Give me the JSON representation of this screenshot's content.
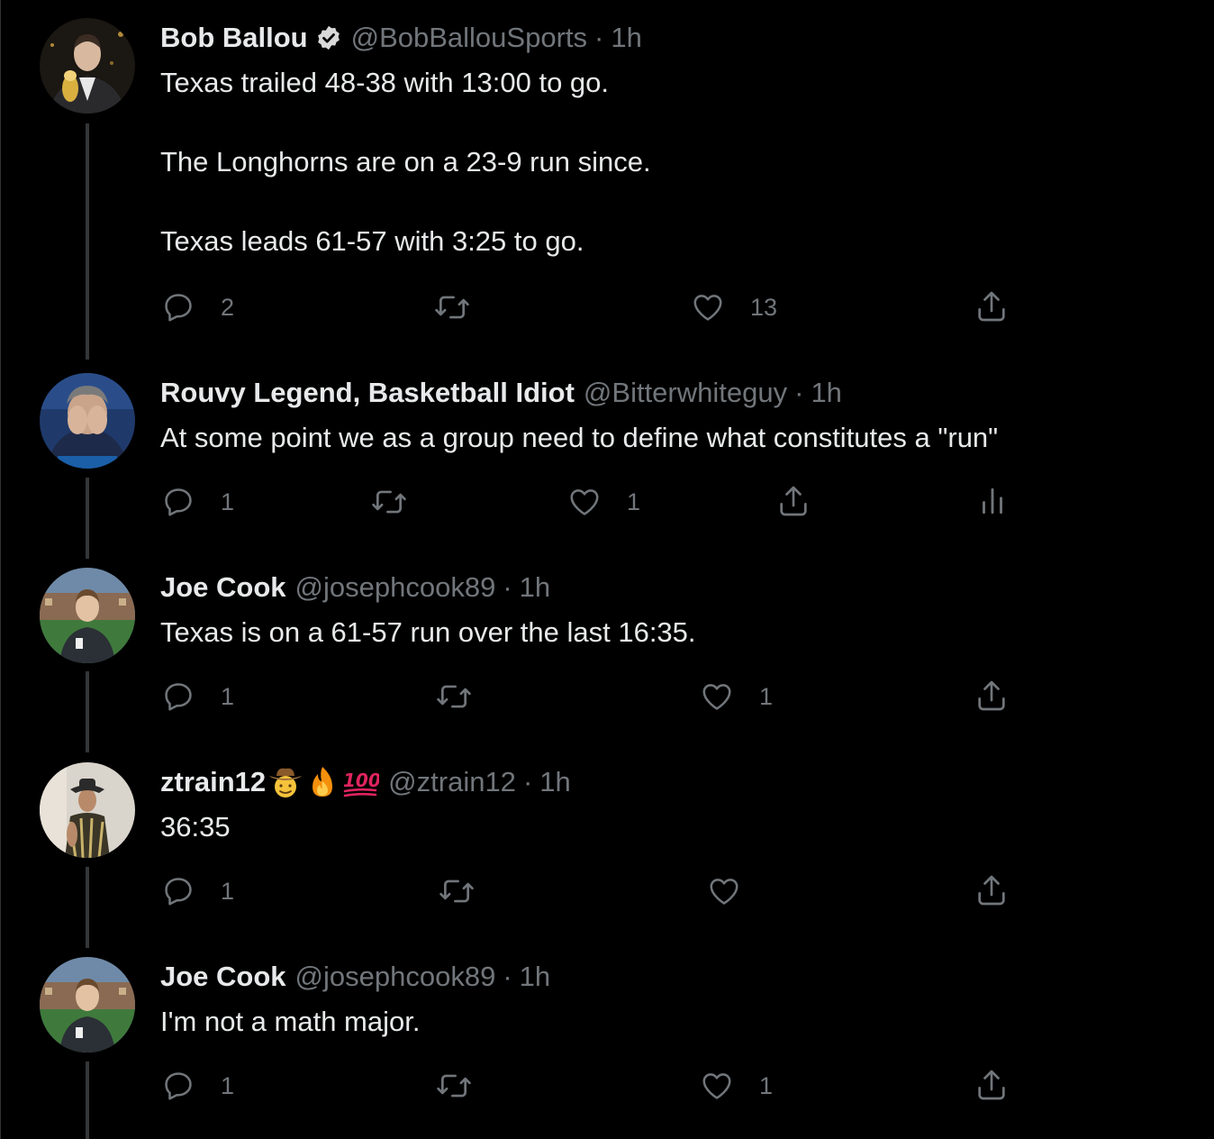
{
  "tweets": [
    {
      "name": "Bob Ballou",
      "handle": "@BobBallouSports",
      "separator": "·",
      "time": "1h",
      "text": "Texas trailed 48-38 with 13:00 to go.\n\nThe Longhorns are on a 23-9 run since.\n\nTexas leads 61-57 with 3:25 to go.",
      "verified": true,
      "replies": "2",
      "retweets": "",
      "likes": "13"
    },
    {
      "name": "Rouvy Legend, Basketball Idiot",
      "handle": "@Bitterwhiteguy",
      "separator": "·",
      "time": "1h",
      "text": "At some point we as a group need to define what constitutes a \"run\"",
      "replies": "1",
      "retweets": "",
      "likes": "1"
    },
    {
      "name": "Joe Cook",
      "handle": "@josephcook89",
      "separator": "·",
      "time": "1h",
      "text": "Texas is on a 61-57 run over the last 16:35.",
      "replies": "1",
      "retweets": "",
      "likes": "1"
    },
    {
      "name": "ztrain12",
      "name_emoji": [
        "cowboy-face",
        "fire",
        "hundred-points"
      ],
      "handle": "@ztrain12",
      "separator": "·",
      "time": "1h",
      "text": "36:35",
      "replies": "1",
      "retweets": "",
      "likes": ""
    },
    {
      "name": "Joe Cook",
      "handle": "@josephcook89",
      "separator": "·",
      "time": "1h",
      "text": "I'm not a math major.",
      "replies": "1",
      "retweets": "",
      "likes": "1"
    }
  ],
  "icons": {
    "reply": "reply-icon",
    "retweet": "retweet-icon",
    "like": "heart-icon",
    "share": "share-icon",
    "analytics": "analytics-icon",
    "verified": "verified-badge-icon"
  },
  "colors": {
    "background": "#000000",
    "primary_text": "#e7e9ea",
    "secondary_text": "#71767b",
    "thread_line": "#333639"
  }
}
